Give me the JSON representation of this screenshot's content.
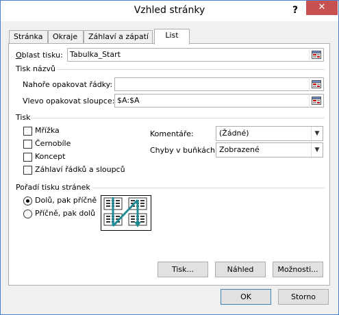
{
  "window": {
    "title": "Vzhled stránky",
    "help_label": "?",
    "close_label": "✕"
  },
  "tabs": [
    {
      "label": "Stránka",
      "active": false
    },
    {
      "label": "Okraje",
      "active": false
    },
    {
      "label": "Záhlaví a zápatí",
      "active": false
    },
    {
      "label": "List",
      "active": true
    }
  ],
  "print_area": {
    "label": "Oblast tisku:",
    "value": "Tabulka_Start"
  },
  "print_titles": {
    "section_label": "Tisk názvů",
    "rows_label": "Nahoře opakovat řádky:",
    "rows_value": "",
    "cols_label": "Vlevo opakovat sloupce:",
    "cols_value": "$A:$A"
  },
  "print": {
    "section_label": "Tisk",
    "gridlines_label": "Mřížka",
    "gridlines_checked": false,
    "bw_label": "Černobíle",
    "bw_checked": false,
    "draft_label": "Koncept",
    "draft_checked": false,
    "headings_label": "Záhlaví řádků a sloupců",
    "headings_checked": false,
    "comments_label": "Komentáře:",
    "comments_value": "(Žádné)",
    "errors_label": "Chyby v buňkách:",
    "errors_value": "Zobrazené"
  },
  "page_order": {
    "section_label": "Pořadí tisku stránek",
    "down_then_over_label": "Dolů, pak příčně",
    "over_then_down_label": "Příčně, pak dolů",
    "selected": "down_then_over"
  },
  "buttons": {
    "print": "Tisk...",
    "preview": "Náhled",
    "options": "Možnosti...",
    "ok": "OK",
    "cancel": "Storno"
  },
  "colors": {
    "accent": "#1e8c96",
    "close_red": "#c75050",
    "border": "#adadad",
    "window_border": "#4a7fd4"
  }
}
